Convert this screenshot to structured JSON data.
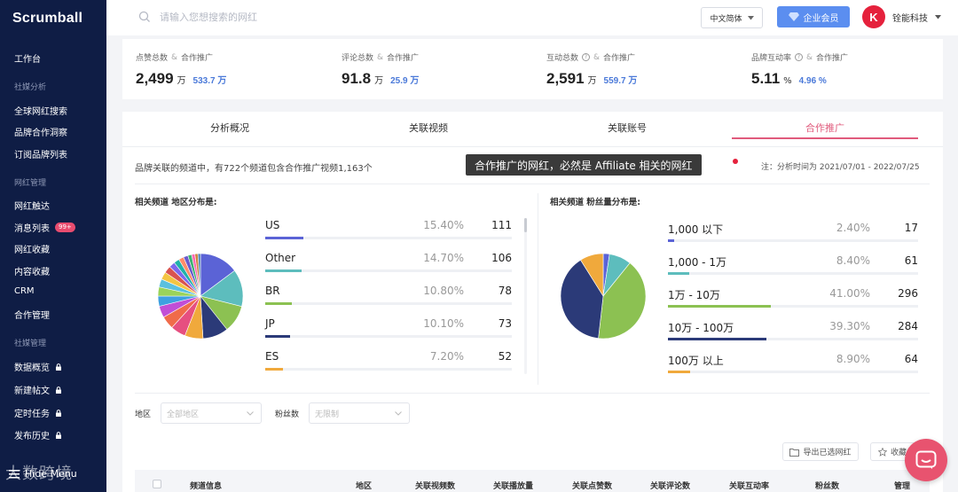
{
  "sidebar": {
    "logo": "Scrumball",
    "workspace": "工作台",
    "groups": [
      {
        "title": "社媒分析",
        "items": [
          {
            "label": "全球网红搜索"
          },
          {
            "label": "品牌合作洞察"
          },
          {
            "label": "订阅品牌列表"
          }
        ]
      },
      {
        "title": "网红管理",
        "items": [
          {
            "label": "网红触达"
          },
          {
            "label": "消息列表",
            "badge": "99+"
          },
          {
            "label": "网红收藏"
          },
          {
            "label": "内容收藏"
          },
          {
            "label": "CRM"
          },
          {
            "label": "合作管理"
          }
        ]
      },
      {
        "title": "社媒管理",
        "items": [
          {
            "label": "数据概览",
            "locked": true
          },
          {
            "label": "新建帖文",
            "locked": true
          },
          {
            "label": "定时任务",
            "locked": true
          },
          {
            "label": "发布历史",
            "locked": true
          }
        ]
      }
    ],
    "hide_menu": "Hide Menu",
    "watermark": "大数跨境"
  },
  "header": {
    "search_placeholder": "请输入您想搜索的网红",
    "language": "中文简体",
    "vip_label": "企业会员",
    "company_initial": "K",
    "company_name": "铨能科技"
  },
  "stats": [
    {
      "label": "点赞总数",
      "amp": "&",
      "sub_label": "合作推广",
      "value": "2,499",
      "unit": "万",
      "sub_value": "533.7 万",
      "help": false
    },
    {
      "label": "评论总数",
      "amp": "&",
      "sub_label": "合作推广",
      "value": "91.8",
      "unit": "万",
      "sub_value": "25.9 万",
      "help": false
    },
    {
      "label": "互动总数",
      "amp": "&",
      "sub_label": "合作推广",
      "value": "2,591",
      "unit": "万",
      "sub_value": "559.7 万",
      "help": true
    },
    {
      "label": "品牌互动率",
      "amp": "&",
      "sub_label": "合作推广",
      "value": "5.11",
      "unit": "%",
      "sub_value": "4.96 %",
      "help": true
    }
  ],
  "tabs": [
    {
      "label": "分析概况",
      "active": false
    },
    {
      "label": "关联视频",
      "active": false
    },
    {
      "label": "关联账号",
      "active": false
    },
    {
      "label": "合作推广",
      "active": true
    }
  ],
  "intro_text": "品牌关联的频道中，有722个频道包含合作推广视频1,163个",
  "tooltip_text": "合作推广的网红，必然是 Affiliate 相关的网红",
  "period_text": "注：分析时间为 2021/07/01 - 2022/07/25",
  "region_section_title": "相关频道 地区分布是:",
  "fans_section_title": "相关频道 粉丝量分布是:",
  "chart_data": [
    {
      "type": "pie",
      "title": "相关频道 地区分布是:",
      "visible_rows": [
        {
          "name": "US",
          "percent": 15.4,
          "percent_label": "15.40%",
          "count": 111,
          "color": "#5b63d6"
        },
        {
          "name": "Other",
          "percent": 14.7,
          "percent_label": "14.70%",
          "count": 106,
          "color": "#5dbdbd"
        },
        {
          "name": "BR",
          "percent": 10.8,
          "percent_label": "10.80%",
          "count": 78,
          "color": "#8cc152"
        },
        {
          "name": "JP",
          "percent": 10.1,
          "percent_label": "10.10%",
          "count": 73,
          "color": "#2b3a78"
        },
        {
          "name": "ES",
          "percent": 7.2,
          "percent_label": "7.20%",
          "count": 52,
          "color": "#f0a93c"
        }
      ],
      "pie_extra_slices": [
        {
          "percent": 6.0,
          "color": "#e64f80"
        },
        {
          "percent": 5.2,
          "color": "#f06b4a"
        },
        {
          "percent": 4.6,
          "color": "#c14ed6"
        },
        {
          "percent": 4.0,
          "color": "#3fa0e0"
        },
        {
          "percent": 3.6,
          "color": "#9ad35a"
        },
        {
          "percent": 3.2,
          "color": "#5bc0de"
        },
        {
          "percent": 3.0,
          "color": "#f4c542"
        },
        {
          "percent": 2.8,
          "color": "#d9534f"
        },
        {
          "percent": 2.4,
          "color": "#7b68ee"
        },
        {
          "percent": 2.2,
          "color": "#20b2aa"
        },
        {
          "percent": 2.0,
          "color": "#ff8c69"
        },
        {
          "percent": 1.8,
          "color": "#6a5acd"
        },
        {
          "percent": 1.5,
          "color": "#3cb371"
        },
        {
          "percent": 1.3,
          "color": "#ff69b4"
        },
        {
          "percent": 1.2,
          "color": "#cd853f"
        },
        {
          "percent": 1.0,
          "color": "#4682b4"
        }
      ]
    },
    {
      "type": "pie",
      "title": "相关频道 粉丝量分布是:",
      "rows": [
        {
          "name": "1,000 以下",
          "percent": 2.4,
          "percent_label": "2.40%",
          "count": 17,
          "color": "#5b63d6"
        },
        {
          "name": "1,000 - 1万",
          "percent": 8.4,
          "percent_label": "8.40%",
          "count": 61,
          "color": "#5dbdbd"
        },
        {
          "name": "1万 - 10万",
          "percent": 41.0,
          "percent_label": "41.00%",
          "count": 296,
          "color": "#8cc152"
        },
        {
          "name": "10万 - 100万",
          "percent": 39.3,
          "percent_label": "39.30%",
          "count": 284,
          "color": "#2b3a78"
        },
        {
          "name": "100万 以上",
          "percent": 8.9,
          "percent_label": "8.90%",
          "count": 64,
          "color": "#f0a93c"
        }
      ]
    }
  ],
  "filters": {
    "region_label": "地区",
    "region_placeholder": "全部地区",
    "fans_label": "粉丝数",
    "fans_placeholder": "无限制"
  },
  "actions": {
    "export_label": "导出已选网红",
    "collect_label": "收藏"
  },
  "table": {
    "headers": [
      "频道信息",
      "地区",
      "关联视频数",
      "关联播放量",
      "关联点赞数",
      "关联评论数",
      "关联互动率",
      "粉丝数",
      "管理"
    ]
  }
}
